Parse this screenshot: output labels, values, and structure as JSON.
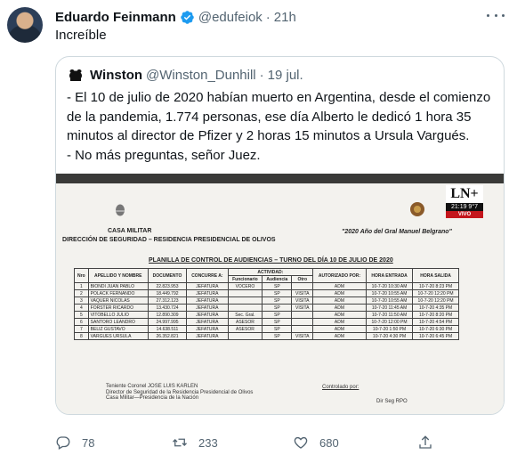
{
  "tweet": {
    "author_name": "Eduardo Feinmann",
    "author_handle": "@edufeiok",
    "time": "21h",
    "text": "Increíble"
  },
  "quote": {
    "author_name": "Winston",
    "author_handle": "@Winston_Dunhill",
    "date": "19 jul.",
    "lines": [
      "- El 10 de julio de 2020 habían muerto en Argentina, desde el comienzo",
      "de la pandemia, 1.774 personas, ese día Alberto le dedicó 1 hora 35",
      "minutos al director de Pfizer y 2 horas 15 minutos a Ursula Vargués.",
      "- No más preguntas, señor Juez."
    ]
  },
  "document": {
    "casa_militar": "CASA MILITAR",
    "direccion": "DIRECCIÓN DE SEGURIDAD – RESIDENCIA PRESIDENCIAL DE OLIVOS",
    "year_motto": "\"2020  Año del Gral Manuel Belgrano\"",
    "planilla_title": "PLANILLA DE CONTROL DE AUDIENCIAS – TURNO DEL DÍA 10 DE JULIO DE 2020",
    "tv_logo": "LN+",
    "tv_clock": "21:19  9°7",
    "tv_live": "VIVO",
    "headers": {
      "nro": "Nro",
      "apellido": "APELLIDO Y NOMBRE",
      "documento": "DOCUMENTO",
      "concurre": "CONCURRE A:",
      "actividad": "ACTIVIDAD:",
      "funcionario": "Funcionario",
      "audiencia": "Audiencia",
      "otro": "Otro",
      "autorizado": "AUTORIZADO POR:",
      "entrada": "HORA ENTRADA",
      "salida": "HORA SALIDA"
    },
    "rows": [
      {
        "nro": "1",
        "name": "BIONDI JUAN PABLO",
        "doc": "22.823.953",
        "concurre": "JEFATURA",
        "func": "VOCERO",
        "aud": "SP",
        "otro": "",
        "auth": "ADM",
        "in": "10-7-20 10:30 AM",
        "out": "10-7-20 8:23 PM"
      },
      {
        "nro": "2",
        "name": "POLACK FERNANDO",
        "doc": "18.449.792",
        "concurre": "JEFATURA",
        "func": "",
        "aud": "SP",
        "otro": "VISITA",
        "auth": "ADM",
        "in": "10-7-20 10:55 AM",
        "out": "10-7-20 12:20 PM"
      },
      {
        "nro": "3",
        "name": "VAQUER NICOLAS",
        "doc": "27.312.123",
        "concurre": "JEFATURA",
        "func": "",
        "aud": "SP",
        "otro": "VISITA",
        "auth": "ADM",
        "in": "10-7-20 10:55 AM",
        "out": "10-7-20 12:20 PM"
      },
      {
        "nro": "4",
        "name": "FORSTER RICARDO",
        "doc": "13.430.724",
        "concurre": "JEFATURA",
        "func": "",
        "aud": "SP",
        "otro": "VISITA",
        "auth": "ADM",
        "in": "10-7-20 11:45 AM",
        "out": "10-7-20 4:35 PM"
      },
      {
        "nro": "5",
        "name": "VITOBELLO JULIO",
        "doc": "12.890.309",
        "concurre": "JEFATURA",
        "func": "Sec. Gral.",
        "aud": "SP",
        "otro": "",
        "auth": "ADM",
        "in": "10-7-20 11:50 AM",
        "out": "10-7-20 8:20 PM"
      },
      {
        "nro": "6",
        "name": "SANTORO LEANDRO",
        "doc": "24.997.995",
        "concurre": "JEFATURA",
        "func": "ASESOR",
        "aud": "SP",
        "otro": "",
        "auth": "ADM",
        "in": "10-7-20 12:00 PM",
        "out": "10-7-20 4:54 PM"
      },
      {
        "nro": "7",
        "name": "BELIZ GUSTAVO",
        "doc": "14.638.511",
        "concurre": "JEFATURA",
        "func": "ASESOR",
        "aud": "SP",
        "otro": "",
        "auth": "ADM",
        "in": "10-7-20 1:50 PM",
        "out": "10-7-20 6:30 PM"
      },
      {
        "nro": "8",
        "name": "VARGUES URSULA",
        "doc": "26.352.821",
        "concurre": "JEFATURA",
        "func": "",
        "aud": "SP",
        "otro": "VISITA",
        "auth": "ADM",
        "in": "10-7-20 4:30 PM",
        "out": "10-7-20 6:45 PM"
      }
    ],
    "signature_block": [
      "Teniente Coronel JOSE LUIS KARLEN",
      "Director de Seguridad de la Residencia Presidencial de Olivos",
      "Casa Militar—Presidencia de la Nación"
    ],
    "controlado_por": "Controlado por:",
    "dir_seg": "Dir Seg RPO"
  },
  "actions": {
    "replies": "78",
    "retweets": "233",
    "likes": "680"
  },
  "colors": {
    "secondary_text": "#536471",
    "verified_blue": "#1d9bf0",
    "border": "#cfd9de"
  }
}
